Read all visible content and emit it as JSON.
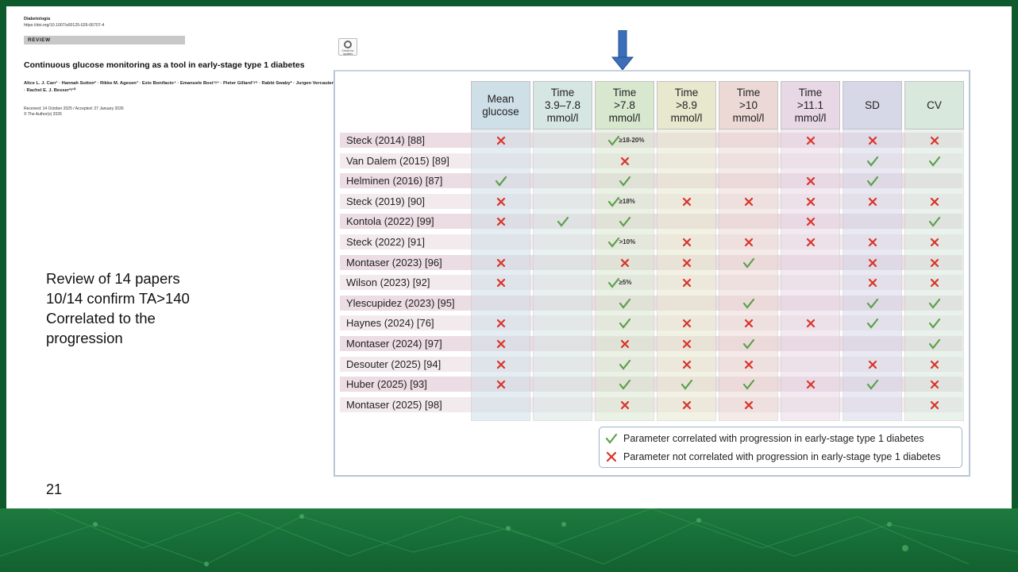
{
  "paper": {
    "journal": "Diabetologia",
    "doi": "https://doi.org/10.1007/s00125-026-06707-4",
    "section": "REVIEW",
    "check_updates": "Check for updates",
    "title": "Continuous glucose monitoring as a tool in early-stage type 1 diabetes",
    "authors": "Alice L. J. Carr¹ · Hannah Sutton² · Rikke M. Agesen³ · Ezio Bonifacio⁴ · Emanuele Bosi⁵ʸ⁶ · Pieter Gillard⁷ʸ⁸ · Rabbi Swaby² · Jurgen Vercauteren⁹ · Rachel E. J. Besser²ʸ¹⁰",
    "received": "Received: 14 October 2025 / Accepted: 27 January 2026",
    "copyright": "© The Author(s) 2026"
  },
  "notes": {
    "line1": "Review of 14 papers",
    "line2": "10/14 confirm TA>140",
    "line3": "Correlated to the",
    "line4": "progression"
  },
  "page_number": "21",
  "colors": {
    "check": "#5aa04a",
    "cross": "#d9342b",
    "arrow": "#3b6fb8",
    "row_strip": "#ecdce3"
  },
  "table": {
    "columns": [
      {
        "line1": "Mean",
        "line2": "glucose",
        "line3": "",
        "bg": "#cfdfe8"
      },
      {
        "line1": "Time",
        "line2": "3.9–7.8",
        "line3": "mmol/l",
        "bg": "#d6e6e2"
      },
      {
        "line1": "Time",
        "line2": ">7.8",
        "line3": "mmol/l",
        "bg": "#d8e8cf"
      },
      {
        "line1": "Time",
        "line2": ">8.9",
        "line3": "mmol/l",
        "bg": "#e8e8cf"
      },
      {
        "line1": "Time",
        "line2": ">10",
        "line3": "mmol/l",
        "bg": "#ecd9d6"
      },
      {
        "line1": "Time",
        "line2": ">11.1",
        "line3": "mmol/l",
        "bg": "#e8d8e6"
      },
      {
        "line1": "SD",
        "line2": "",
        "line3": "",
        "bg": "#d6d8e8"
      },
      {
        "line1": "CV",
        "line2": "",
        "line3": "",
        "bg": "#d8e8dc"
      }
    ],
    "rows": [
      {
        "study": "Steck (2014) [88]",
        "cells": [
          "x",
          "",
          "c:≥18-20%",
          "",
          "",
          "x",
          "x",
          "x"
        ]
      },
      {
        "study": "Van Dalem (2015) [89]",
        "cells": [
          "",
          "",
          "x",
          "",
          "",
          "",
          "c",
          "c"
        ]
      },
      {
        "study": "Helminen (2016) [87]",
        "cells": [
          "c",
          "",
          "c",
          "",
          "",
          "x",
          "c",
          ""
        ]
      },
      {
        "study": "Steck (2019) [90]",
        "cells": [
          "x",
          "",
          "c:≥18%",
          "x",
          "x",
          "x",
          "x",
          "x"
        ]
      },
      {
        "study": "Kontola (2022) [99]",
        "cells": [
          "x",
          "c",
          "c",
          "",
          "",
          "x",
          "",
          "c"
        ]
      },
      {
        "study": "Steck (2022) [91]",
        "cells": [
          "",
          "",
          "c:>10%",
          "x",
          "x",
          "x",
          "x",
          "x"
        ]
      },
      {
        "study": "Montaser (2023) [96]",
        "cells": [
          "x",
          "",
          "x",
          "x",
          "c",
          "",
          "x",
          "x"
        ]
      },
      {
        "study": "Wilson (2023) [92]",
        "cells": [
          "x",
          "",
          "c:≥5%",
          "x",
          "",
          "",
          "x",
          "x"
        ]
      },
      {
        "study": "Ylescupidez (2023) [95]",
        "cells": [
          "",
          "",
          "c",
          "",
          "c",
          "",
          "c",
          "c"
        ]
      },
      {
        "study": "Haynes (2024) [76]",
        "cells": [
          "x",
          "",
          "c",
          "x",
          "x",
          "x",
          "c",
          "c"
        ]
      },
      {
        "study": "Montaser (2024) [97]",
        "cells": [
          "x",
          "",
          "x",
          "x",
          "c",
          "",
          "",
          "c"
        ]
      },
      {
        "study": "Desouter (2025) [94]",
        "cells": [
          "x",
          "",
          "c",
          "x",
          "x",
          "",
          "x",
          "x"
        ]
      },
      {
        "study": "Huber (2025) [93]",
        "cells": [
          "x",
          "",
          "c",
          "c",
          "c",
          "x",
          "c",
          "x"
        ]
      },
      {
        "study": "Montaser (2025) [98]",
        "cells": [
          "",
          "",
          "x",
          "x",
          "x",
          "",
          "",
          "x"
        ]
      }
    ],
    "legend": {
      "correlated": "Parameter correlated with progression in early-stage type 1 diabetes",
      "not_correlated": "Parameter not correlated with progression in early-stage type 1 diabetes"
    }
  }
}
